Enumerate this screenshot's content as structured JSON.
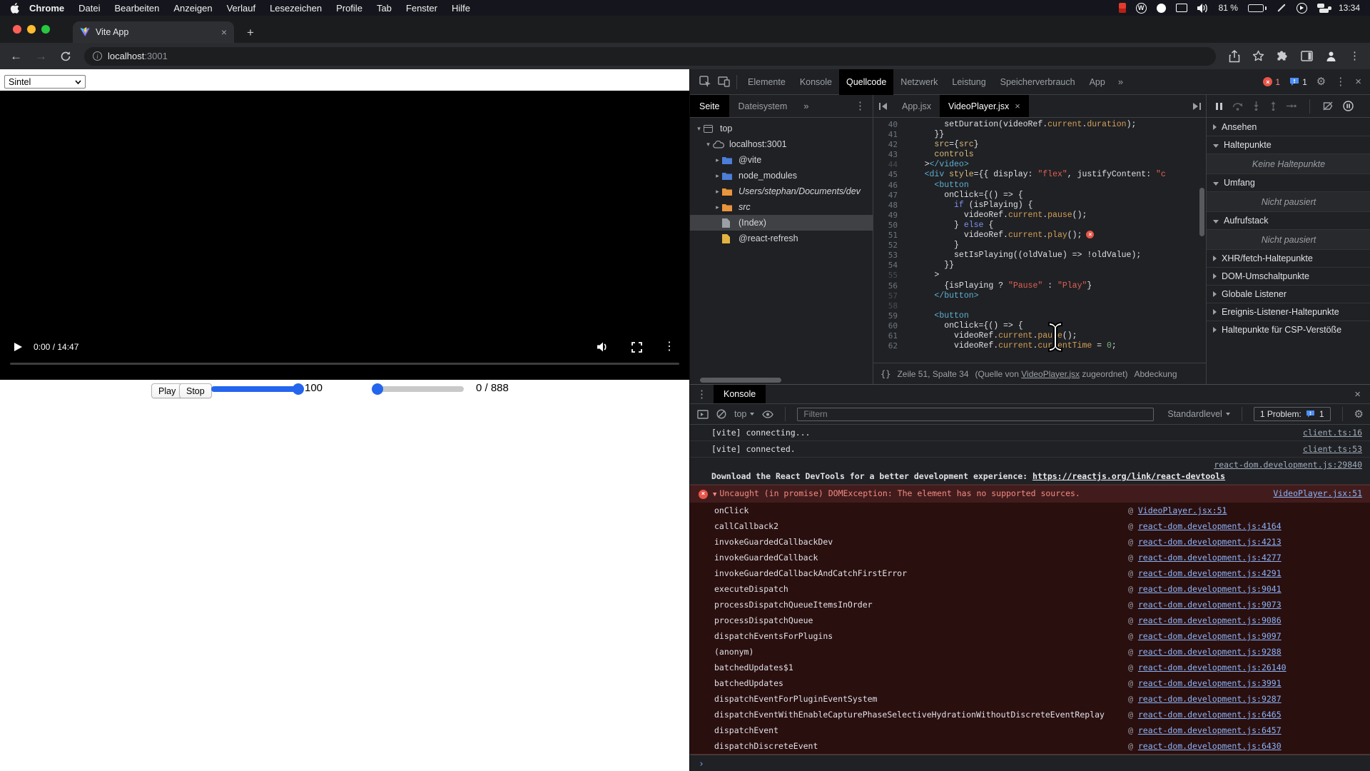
{
  "menubar": {
    "items": [
      "Chrome",
      "Datei",
      "Bearbeiten",
      "Anzeigen",
      "Verlauf",
      "Lesezeichen",
      "Profile",
      "Tab",
      "Fenster",
      "Hilfe"
    ],
    "battery": "81 %",
    "clock": "13:34"
  },
  "browser": {
    "tab_title": "Vite App",
    "url_host": "localhost",
    "url_port": ":3001",
    "new_tab_symbol": "+",
    "tab_close_symbol": "×"
  },
  "page": {
    "select_value": "Sintel",
    "video_time": "0:00 / 14:47",
    "play_label": "Play",
    "stop_label": "Stop",
    "slider1_label": "100",
    "slider2_label": "0 / 888",
    "accent_blue": "#2465ee"
  },
  "devtools": {
    "top_tabs": [
      "Elemente",
      "Konsole",
      "Quellcode",
      "Netzwerk",
      "Leistung",
      "Speicherverbrauch",
      "App"
    ],
    "selected_tab": "Quellcode",
    "more_tabs_symbol": "»",
    "error_badge": "1",
    "issue_badge": "1",
    "sources": {
      "nav_tabs": [
        {
          "label": "Seite",
          "selected": true
        },
        {
          "label": "Dateisystem",
          "selected": false
        }
      ],
      "tree": [
        {
          "label": "top",
          "icon": "frame",
          "depth": 0,
          "twisty": "expanded"
        },
        {
          "label": "localhost:3001",
          "icon": "cloud",
          "depth": 1,
          "twisty": "expanded"
        },
        {
          "label": "@vite",
          "icon": "folder-blue",
          "depth": 2,
          "twisty": "collapsed"
        },
        {
          "label": "node_modules",
          "icon": "folder-blue",
          "depth": 2,
          "twisty": "collapsed"
        },
        {
          "label": "Users/stephan/Documents/dev",
          "icon": "folder-orange",
          "depth": 2,
          "twisty": "collapsed",
          "italic": true
        },
        {
          "label": "src",
          "icon": "folder-orange",
          "depth": 2,
          "twisty": "collapsed",
          "italic": true
        },
        {
          "label": "(Index)",
          "icon": "file-gray",
          "depth": 2,
          "selected": true
        },
        {
          "label": "@react-refresh",
          "icon": "file-yellow",
          "depth": 2
        }
      ],
      "editor_tabs": [
        {
          "label": "App.jsx",
          "active": false
        },
        {
          "label": "VideoPlayer.jsx",
          "active": true,
          "close_symbol": "×"
        }
      ],
      "code_lines": [
        {
          "n": "40",
          "tokens": [
            [
              "pl",
              "        setDuration(videoRef."
            ],
            [
              "prop",
              "current"
            ],
            [
              "pl",
              "."
            ],
            [
              "prop",
              "duration"
            ],
            [
              "pl",
              ");"
            ]
          ]
        },
        {
          "n": "41",
          "tokens": [
            [
              "pl",
              "      }}"
            ]
          ]
        },
        {
          "n": "42",
          "tokens": [
            [
              "pl",
              "      "
            ],
            [
              "attr",
              "src"
            ],
            [
              "pl",
              "={"
            ],
            [
              "attr",
              "src"
            ],
            [
              "pl",
              "}"
            ]
          ]
        },
        {
          "n": "43",
          "tokens": [
            [
              "pl",
              "      "
            ],
            [
              "attr",
              "controls"
            ]
          ]
        },
        {
          "n": "44",
          "dim": true,
          "tokens": [
            [
              "pl",
              "    >"
            ],
            [
              "tag",
              "</video>"
            ]
          ]
        },
        {
          "n": "45",
          "tokens": [
            [
              "pl",
              "    "
            ],
            [
              "tag",
              "<div"
            ],
            [
              "pl",
              " "
            ],
            [
              "attr",
              "style"
            ],
            [
              "pl",
              "={{ display: "
            ],
            [
              "str",
              "\"flex\""
            ],
            [
              "pl",
              ", justifyContent: "
            ],
            [
              "str",
              "\"c"
            ]
          ]
        },
        {
          "n": "46",
          "tokens": [
            [
              "pl",
              "      "
            ],
            [
              "tag",
              "<button"
            ]
          ]
        },
        {
          "n": "47",
          "tokens": [
            [
              "pl",
              "        onClick={() => {"
            ]
          ]
        },
        {
          "n": "48",
          "tokens": [
            [
              "pl",
              "          "
            ],
            [
              "kw",
              "if"
            ],
            [
              "pl",
              " (isPlaying) {"
            ]
          ]
        },
        {
          "n": "49",
          "tokens": [
            [
              "pl",
              "            videoRef."
            ],
            [
              "prop",
              "current"
            ],
            [
              "pl",
              "."
            ],
            [
              "prop",
              "pause"
            ],
            [
              "pl",
              "();"
            ]
          ]
        },
        {
          "n": "50",
          "tokens": [
            [
              "pl",
              "          } "
            ],
            [
              "kw",
              "else"
            ],
            [
              "pl",
              " {"
            ]
          ]
        },
        {
          "n": "51",
          "error": true,
          "tokens": [
            [
              "pl",
              "            videoRef."
            ],
            [
              "prop",
              "current"
            ],
            [
              "pl",
              "."
            ],
            [
              "prop",
              "play"
            ],
            [
              "pl",
              "();"
            ]
          ]
        },
        {
          "n": "52",
          "tokens": [
            [
              "pl",
              "          }"
            ]
          ]
        },
        {
          "n": "53",
          "tokens": [
            [
              "pl",
              "          setIsPlaying((oldValue) => !oldValue);"
            ]
          ]
        },
        {
          "n": "54",
          "tokens": [
            [
              "pl",
              "        }}"
            ]
          ]
        },
        {
          "n": "55",
          "dim": true,
          "tokens": [
            [
              "pl",
              "      >"
            ]
          ]
        },
        {
          "n": "56",
          "tokens": [
            [
              "pl",
              "        {isPlaying ? "
            ],
            [
              "str",
              "\"Pause\""
            ],
            [
              "pl",
              " : "
            ],
            [
              "str",
              "\"Play\""
            ],
            [
              "pl",
              "}"
            ]
          ]
        },
        {
          "n": "57",
          "dim": true,
          "tokens": [
            [
              "pl",
              "      "
            ],
            [
              "tag",
              "</button>"
            ]
          ]
        },
        {
          "n": "58",
          "dim": true,
          "tokens": []
        },
        {
          "n": "59",
          "tokens": [
            [
              "pl",
              "      "
            ],
            [
              "tag",
              "<button"
            ]
          ]
        },
        {
          "n": "60",
          "tokens": [
            [
              "pl",
              "        onClick={() => {"
            ]
          ]
        },
        {
          "n": "61",
          "tokens": [
            [
              "pl",
              "          videoRef."
            ],
            [
              "prop",
              "current"
            ],
            [
              "pl",
              "."
            ],
            [
              "prop",
              "pause"
            ],
            [
              "pl",
              "();"
            ]
          ]
        },
        {
          "n": "62",
          "tokens": [
            [
              "pl",
              "          videoRef."
            ],
            [
              "prop",
              "current"
            ],
            [
              "pl",
              "."
            ],
            [
              "prop",
              "currentTime"
            ],
            [
              "pl",
              " = "
            ],
            [
              "num",
              "0"
            ],
            [
              "pl",
              ";"
            ]
          ]
        }
      ],
      "status": {
        "braces": "{}",
        "line_col": "Zeile 51, Spalte 34",
        "source_prefix": "(Quelle von ",
        "source_link": "VideoPlayer.jsx",
        "source_suffix": " zugeordnet)",
        "coverage": "Abdeckung"
      }
    },
    "debugger": {
      "sections": [
        {
          "label": "Ansehen",
          "state": "collapsed"
        },
        {
          "label": "Haltepunkte",
          "state": "expanded",
          "note": "Keine Haltepunkte"
        },
        {
          "label": "Umfang",
          "state": "expanded",
          "note": "Nicht pausiert"
        },
        {
          "label": "Aufrufstack",
          "state": "expanded",
          "note": "Nicht pausiert"
        },
        {
          "label": "XHR/fetch-Haltepunkte",
          "state": "collapsed"
        },
        {
          "label": "DOM-Umschaltpunkte",
          "state": "collapsed"
        },
        {
          "label": "Globale Listener",
          "state": "collapsed"
        },
        {
          "label": "Ereignis-Listener-Haltepunkte",
          "state": "collapsed"
        },
        {
          "label": "Haltepunkte für CSP-Verstöße",
          "state": "collapsed"
        }
      ]
    },
    "console": {
      "title": "Konsole",
      "context": "top",
      "filter_placeholder": "Filtern",
      "level": "Standardlevel",
      "problems_label": "1 Problem:",
      "problems_count": "1",
      "close_symbol": "×",
      "info_messages": [
        {
          "text": "[vite] connecting...",
          "link": "client.ts:16"
        },
        {
          "text": "[vite] connected.",
          "link": "client.ts:53"
        }
      ],
      "react_devtools": {
        "link_top": "react-dom.development.js:29840",
        "text": "Download the React DevTools for a better development experience: ",
        "url": "https://reactjs.org/link/react-devtools"
      },
      "error": {
        "text": "Uncaught (in promise) DOMException: The element has no supported sources.",
        "link": "VideoPlayer.jsx:51"
      },
      "stack": [
        {
          "fn": "onClick",
          "link": "VideoPlayer.jsx:51"
        },
        {
          "fn": "callCallback2",
          "link": "react-dom.development.js:4164"
        },
        {
          "fn": "invokeGuardedCallbackDev",
          "link": "react-dom.development.js:4213"
        },
        {
          "fn": "invokeGuardedCallback",
          "link": "react-dom.development.js:4277"
        },
        {
          "fn": "invokeGuardedCallbackAndCatchFirstError",
          "link": "react-dom.development.js:4291"
        },
        {
          "fn": "executeDispatch",
          "link": "react-dom.development.js:9041"
        },
        {
          "fn": "processDispatchQueueItemsInOrder",
          "link": "react-dom.development.js:9073"
        },
        {
          "fn": "processDispatchQueue",
          "link": "react-dom.development.js:9086"
        },
        {
          "fn": "dispatchEventsForPlugins",
          "link": "react-dom.development.js:9097"
        },
        {
          "fn": "(anonym)",
          "link": "react-dom.development.js:9288"
        },
        {
          "fn": "batchedUpdates$1",
          "link": "react-dom.development.js:26140"
        },
        {
          "fn": "batchedUpdates",
          "link": "react-dom.development.js:3991"
        },
        {
          "fn": "dispatchEventForPluginEventSystem",
          "link": "react-dom.development.js:9287"
        },
        {
          "fn": "dispatchEventWithEnableCapturePhaseSelectiveHydrationWithoutDiscreteEventReplay",
          "link": "react-dom.development.js:6465"
        },
        {
          "fn": "dispatchEvent",
          "link": "react-dom.development.js:6457"
        },
        {
          "fn": "dispatchDiscreteEvent",
          "link": "react-dom.development.js:6430"
        }
      ],
      "prompt_symbol": "›"
    }
  }
}
